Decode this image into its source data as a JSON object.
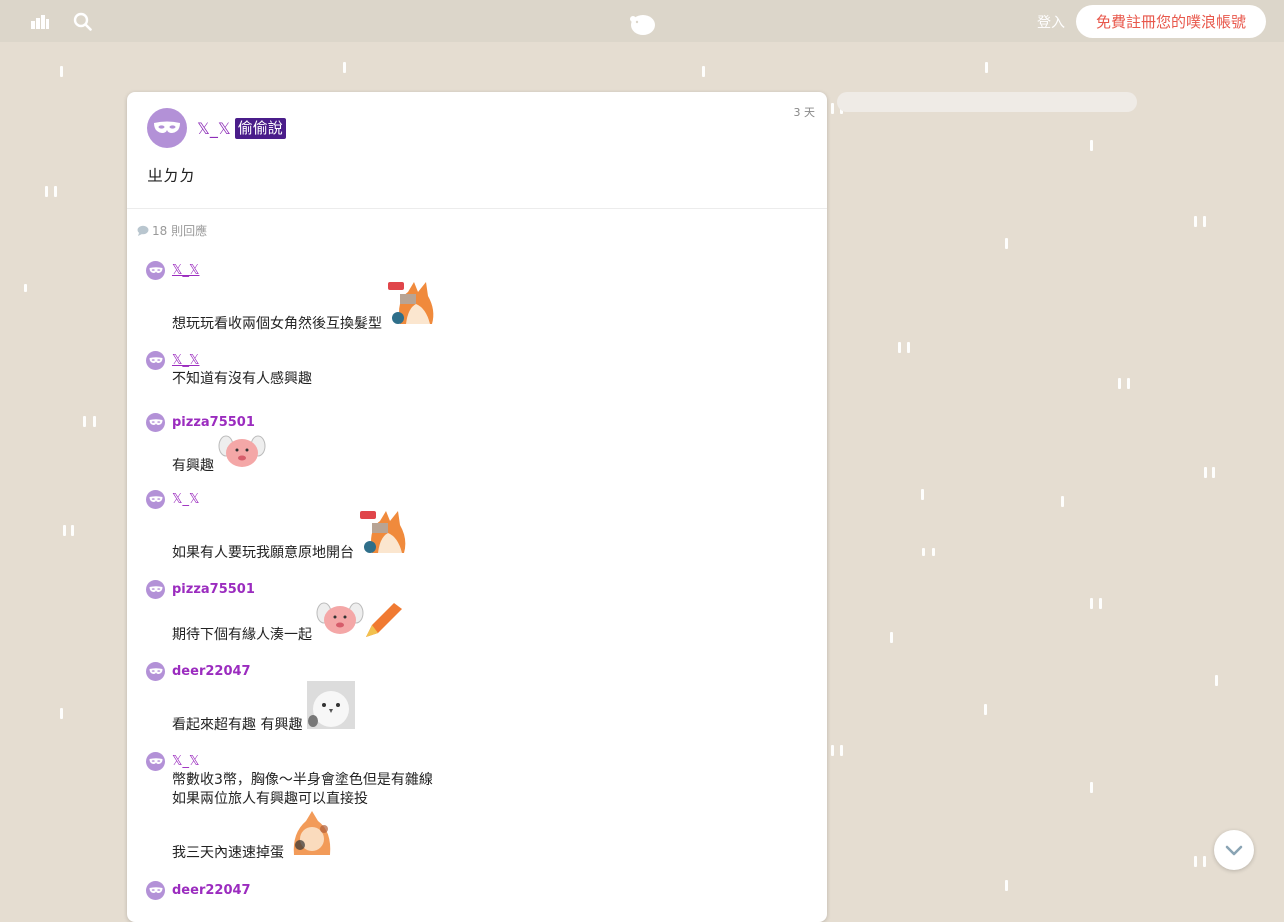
{
  "topbar": {
    "login_label": "登入",
    "signup_label": "免費註冊您的噗浪帳號",
    "colors": {
      "bar": "#dcd6ca",
      "signup_text": "#e8584c"
    }
  },
  "post": {
    "author": "𝕏_𝕏",
    "secret_label": "偷偷說",
    "time": "3 天",
    "content": "ㄓㄉㄉ",
    "reply_count": "18 則回應"
  },
  "replies": [
    {
      "author": "𝕏_𝕏",
      "lines": [
        "想玩玩看收兩個女角然後互換髮型"
      ],
      "sticker": "live-fox-sticker"
    },
    {
      "author": "𝕏_𝕏",
      "lines": [
        "不知道有沒有人感興趣"
      ],
      "sticker": ""
    },
    {
      "author": "pizza75501",
      "lines": [
        "有興趣"
      ],
      "sticker": "pink-dog-sticker"
    },
    {
      "author": "𝕏_𝕏",
      "lines": [
        "如果有人要玩我願意原地開台"
      ],
      "sticker": "live-fox-sticker"
    },
    {
      "author": "pizza75501",
      "lines": [
        "期待下個有緣人湊一起"
      ],
      "sticker": "pink-dog-crayon-sticker"
    },
    {
      "author": "deer22047",
      "lines": [
        "看起來超有趣 有興趣"
      ],
      "sticker": "owl-sticker"
    },
    {
      "author": "𝕏_𝕏",
      "lines": [
        "幣數收3幣，胸像～半身會塗色但是有雜線",
        "如果兩位旅人有興趣可以直接投",
        "我三天內速速掉蛋"
      ],
      "sticker": "blurry-fox-sticker"
    },
    {
      "author": "deer22047",
      "lines": [],
      "sticker": ""
    }
  ]
}
